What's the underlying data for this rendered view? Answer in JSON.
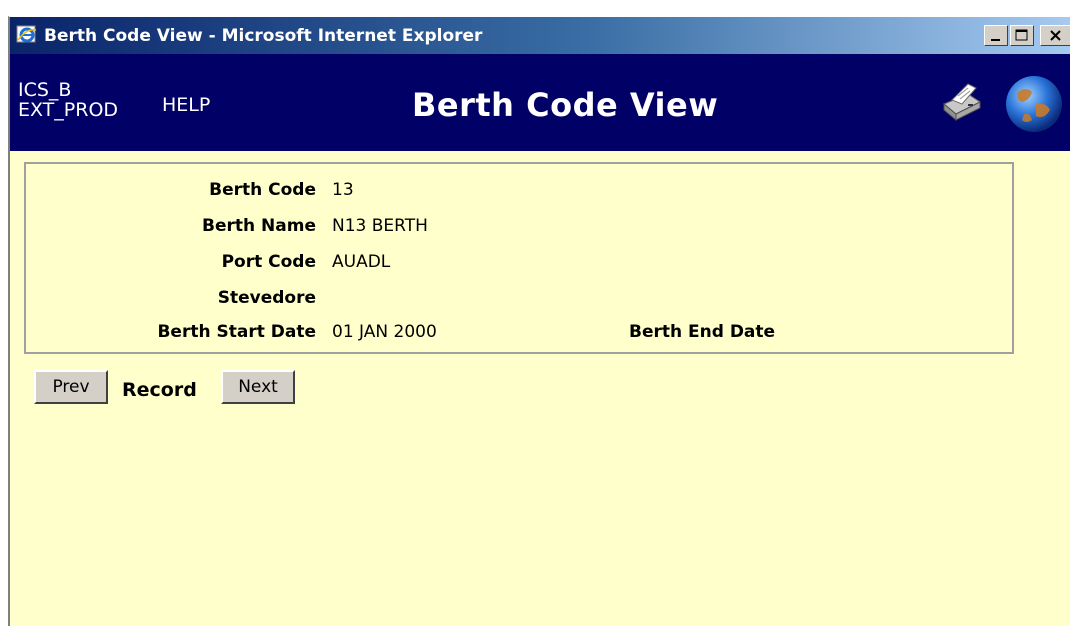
{
  "window": {
    "title": "Berth Code View - Microsoft Internet Explorer"
  },
  "header": {
    "env_line1": "ICS_B",
    "env_line2": "EXT_PROD",
    "help_label": "HELP",
    "page_title": "Berth Code View",
    "icons": [
      "print-icon",
      "globe-icon"
    ]
  },
  "details": {
    "berth_code_label": "Berth Code",
    "berth_code": "13",
    "berth_name_label": "Berth Name",
    "berth_name": "N13 BERTH",
    "port_code_label": "Port Code",
    "port_code": "AUADL",
    "stevedore_label": "Stevedore",
    "stevedore": "",
    "start_date_label": "Berth Start Date",
    "start_date": "01 JAN 2000",
    "end_date_label": "Berth End Date",
    "end_date": ""
  },
  "nav": {
    "prev_label": "Prev",
    "record_label": "Record",
    "next_label": "Next"
  },
  "colors": {
    "header_bg": "#000066",
    "content_bg": "#ffffcc",
    "titlebar_start": "#0a246a"
  }
}
